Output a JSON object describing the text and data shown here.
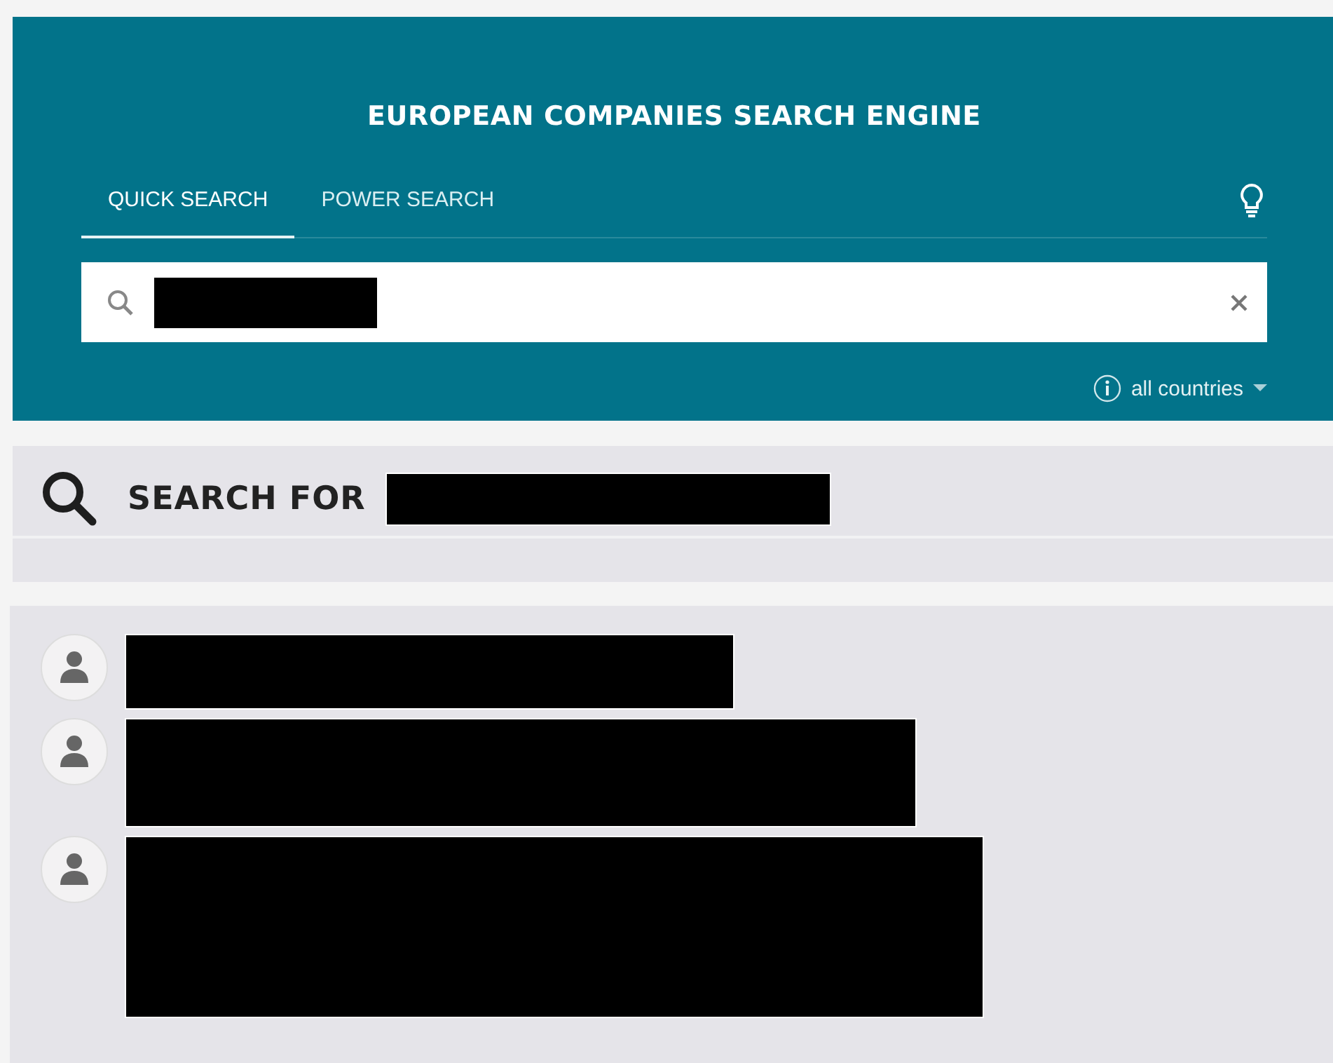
{
  "header": {
    "title": "EUROPEAN COMPANIES SEARCH ENGINE",
    "tabs": [
      {
        "label": "QUICK SEARCH",
        "selected": true
      },
      {
        "label": "POWER SEARCH",
        "selected": false
      }
    ],
    "search": {
      "value_redacted": true
    },
    "country_filter": {
      "label": "all countries"
    }
  },
  "results_heading": {
    "label": "SEARCH FOR",
    "query_redacted": true
  },
  "results": [
    {
      "kind": "person"
    },
    {
      "kind": "person"
    },
    {
      "kind": "person"
    }
  ]
}
